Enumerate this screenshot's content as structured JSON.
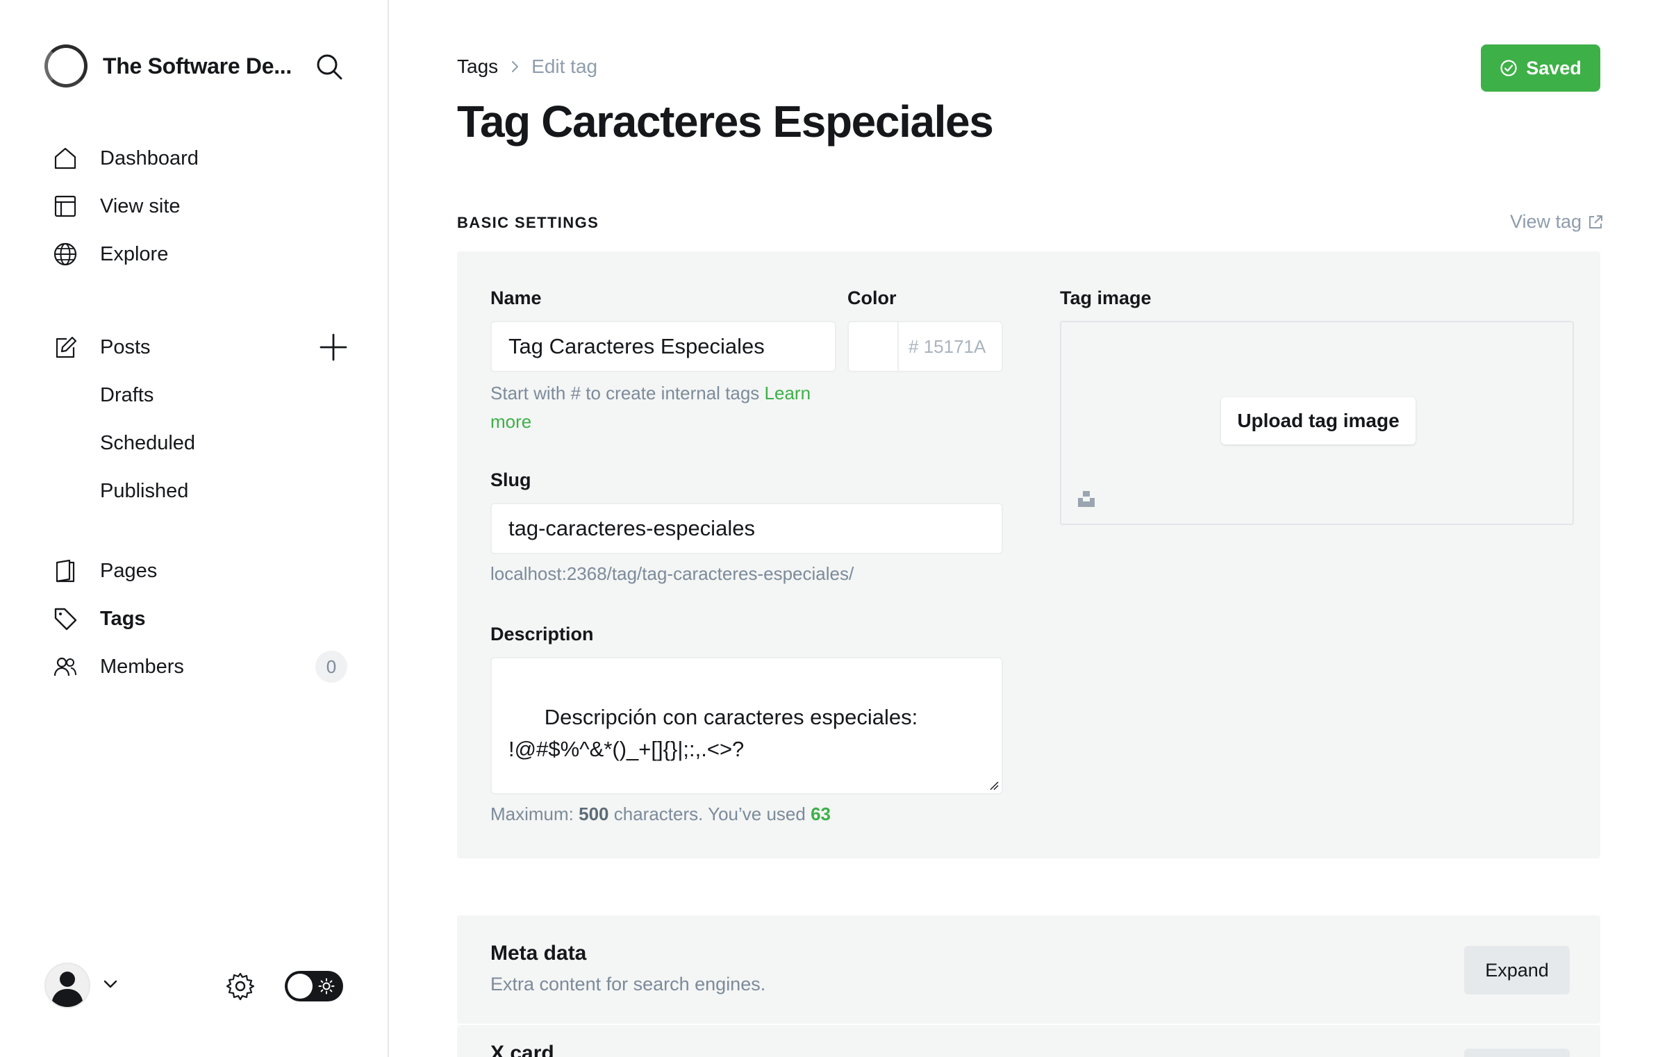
{
  "sidebar": {
    "brand_name": "The Software De...",
    "items": [
      {
        "label": "Dashboard",
        "icon": "home-icon"
      },
      {
        "label": "View site",
        "icon": "layout-icon"
      },
      {
        "label": "Explore",
        "icon": "globe-icon"
      },
      {
        "label": "Posts",
        "icon": "edit-icon"
      },
      {
        "label": "Drafts"
      },
      {
        "label": "Scheduled"
      },
      {
        "label": "Published"
      },
      {
        "label": "Pages",
        "icon": "page-icon"
      },
      {
        "label": "Tags",
        "icon": "tag-icon",
        "active": true
      },
      {
        "label": "Members",
        "icon": "members-icon",
        "count": "0"
      }
    ]
  },
  "header": {
    "breadcrumb_root": "Tags",
    "breadcrumb_current": "Edit tag",
    "title": "Tag Caracteres Especiales",
    "saved_label": "Saved"
  },
  "basic": {
    "section_label": "BASIC SETTINGS",
    "view_tag_label": "View tag",
    "name_label": "Name",
    "name_value": "Tag Caracteres Especiales",
    "name_hint": "Start with # to create internal tags",
    "name_hint_link_1": "Learn",
    "name_hint_link_2": "more",
    "color_label": "Color",
    "color_placeholder": "15171A",
    "color_hash": "#",
    "slug_label": "Slug",
    "slug_value": "tag-caracteres-especiales",
    "slug_url": "localhost:2368/tag/tag-caracteres-especiales/",
    "description_label": "Description",
    "description_value": "Descripción con caracteres especiales:\n!@#$%^&*()_+[]{}|;:,.<>?",
    "desc_hint_prefix": "Maximum:",
    "desc_hint_max": "500",
    "desc_hint_middle": "characters. You’ve used",
    "desc_hint_used": "63",
    "image_label": "Tag image",
    "upload_label": "Upload tag image"
  },
  "meta": {
    "title": "Meta data",
    "subtitle": "Extra content for search engines.",
    "expand_label": "Expand"
  },
  "xcard": {
    "title": "X card"
  },
  "colors": {
    "accent_green": "#3eb048",
    "panel_bg": "#f4f5f5",
    "text_dark": "#15171a",
    "text_muted": "#7c8b9a"
  }
}
